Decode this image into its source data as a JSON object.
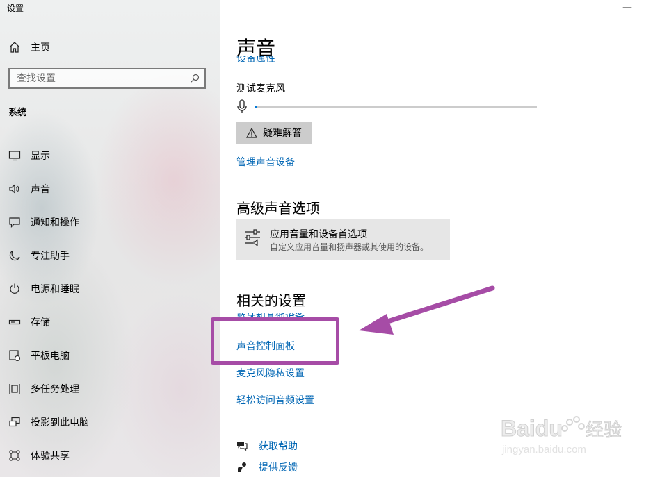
{
  "window": {
    "title": "设置",
    "close_glyph": "—"
  },
  "sidebar": {
    "home_label": "主页",
    "search_placeholder": "查找设置",
    "section_title": "系统",
    "items": [
      {
        "label": "显示",
        "icon": "display-icon"
      },
      {
        "label": "声音",
        "icon": "speaker-icon"
      },
      {
        "label": "通知和操作",
        "icon": "notification-icon"
      },
      {
        "label": "专注助手",
        "icon": "moon-icon"
      },
      {
        "label": "电源和睡眠",
        "icon": "power-icon"
      },
      {
        "label": "存储",
        "icon": "storage-icon"
      },
      {
        "label": "平板电脑",
        "icon": "tablet-icon"
      },
      {
        "label": "多任务处理",
        "icon": "multitask-icon"
      },
      {
        "label": "投影到此电脑",
        "icon": "project-icon"
      },
      {
        "label": "体验共享",
        "icon": "share-icon"
      }
    ]
  },
  "main": {
    "title": "声音",
    "cut_link": "设备属性",
    "mic_test_label": "测试麦克风",
    "mic_level": 0.01,
    "troubleshoot_label": "疑难解答",
    "manage_devices_link": "管理声音设备",
    "advanced_heading": "高级声音选项",
    "app_volume_title": "应用音量和设备首选项",
    "app_volume_desc": "自定义应用音量和扬声器或其使用的设备。",
    "related_heading": "相关的设置",
    "related_cut_link": "蓝牙和其他设备",
    "related_links": [
      "声音控制面板",
      "麦克风隐私设置",
      "轻松访问音频设置"
    ],
    "help_links": [
      "获取帮助",
      "提供反馈"
    ]
  },
  "annotation": {
    "color": "#a64ca6"
  },
  "colors": {
    "link": "#0066b4",
    "accent": "#0078d7"
  }
}
